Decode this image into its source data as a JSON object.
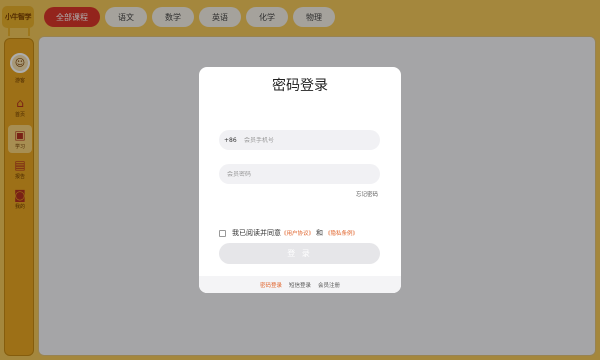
{
  "app": {
    "logo_text": "小牛智学"
  },
  "tabs": [
    {
      "label": "全部课程",
      "active": true
    },
    {
      "label": "语文",
      "active": false
    },
    {
      "label": "数学",
      "active": false
    },
    {
      "label": "英语",
      "active": false
    },
    {
      "label": "化学",
      "active": false
    },
    {
      "label": "物理",
      "active": false
    }
  ],
  "sidebar": {
    "avatar_label": "游客",
    "items": [
      {
        "label": "首页",
        "icon": "home-icon"
      },
      {
        "label": "学习",
        "icon": "study-icon"
      },
      {
        "label": "报告",
        "icon": "report-icon"
      },
      {
        "label": "我的",
        "icon": "profile-icon"
      }
    ]
  },
  "modal": {
    "title": "密码登录",
    "country_code": "+86",
    "phone_placeholder": "会员手机号",
    "password_placeholder": "会员密码",
    "forgot_label": "忘记密码",
    "agree_text": "我已阅读并同意",
    "user_agreement": "《用户协议》",
    "and_text": "和",
    "privacy_policy": "《隐私条例》",
    "login_label": "登 录",
    "footer": {
      "password_login": "密码登录",
      "sms_login": "短信登录",
      "register": "会员注册"
    }
  },
  "colors": {
    "accent": "#e0632a",
    "active_tab": "#d9362a",
    "sidebar": "#e8a622"
  }
}
